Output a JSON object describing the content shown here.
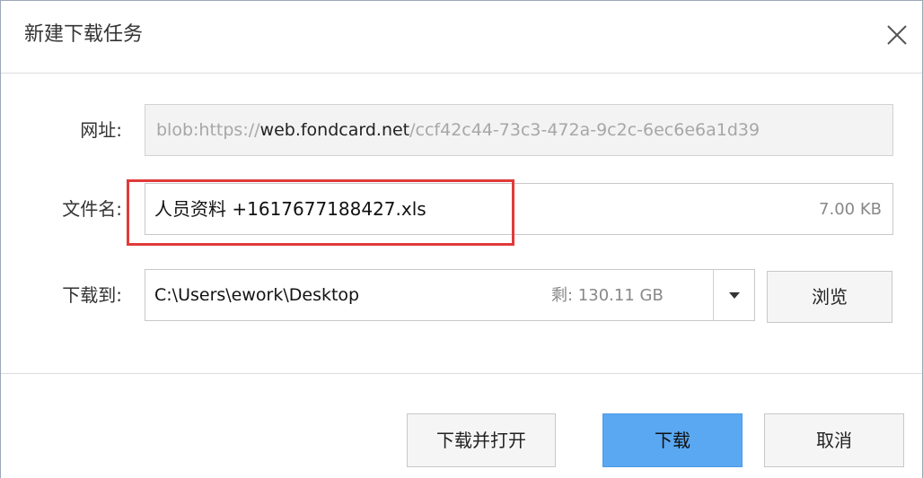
{
  "dialog": {
    "title": "新建下载任务",
    "close_icon": "close-icon"
  },
  "url": {
    "label": "网址:",
    "prefix": "blob:https://",
    "host": "web.fondcard.net",
    "suffix": "/ccf42c44-73c3-472a-9c2c-6ec6e6a1d39"
  },
  "filename": {
    "label": "文件名:",
    "value": "人员资料 +1617677188427.xls",
    "size": "7.00 KB"
  },
  "save_to": {
    "label": "下载到:",
    "path": "C:\\Users\\ework\\Desktop",
    "free_space": "剩: 130.11 GB",
    "dropdown_icon": "caret-down-icon",
    "browse_label": "浏览"
  },
  "footer": {
    "download_and_open_label": "下载并打开",
    "download_label": "下载",
    "cancel_label": "取消"
  },
  "colors": {
    "primary_button": "#5aa7f2",
    "highlight": "#e13a3a"
  }
}
